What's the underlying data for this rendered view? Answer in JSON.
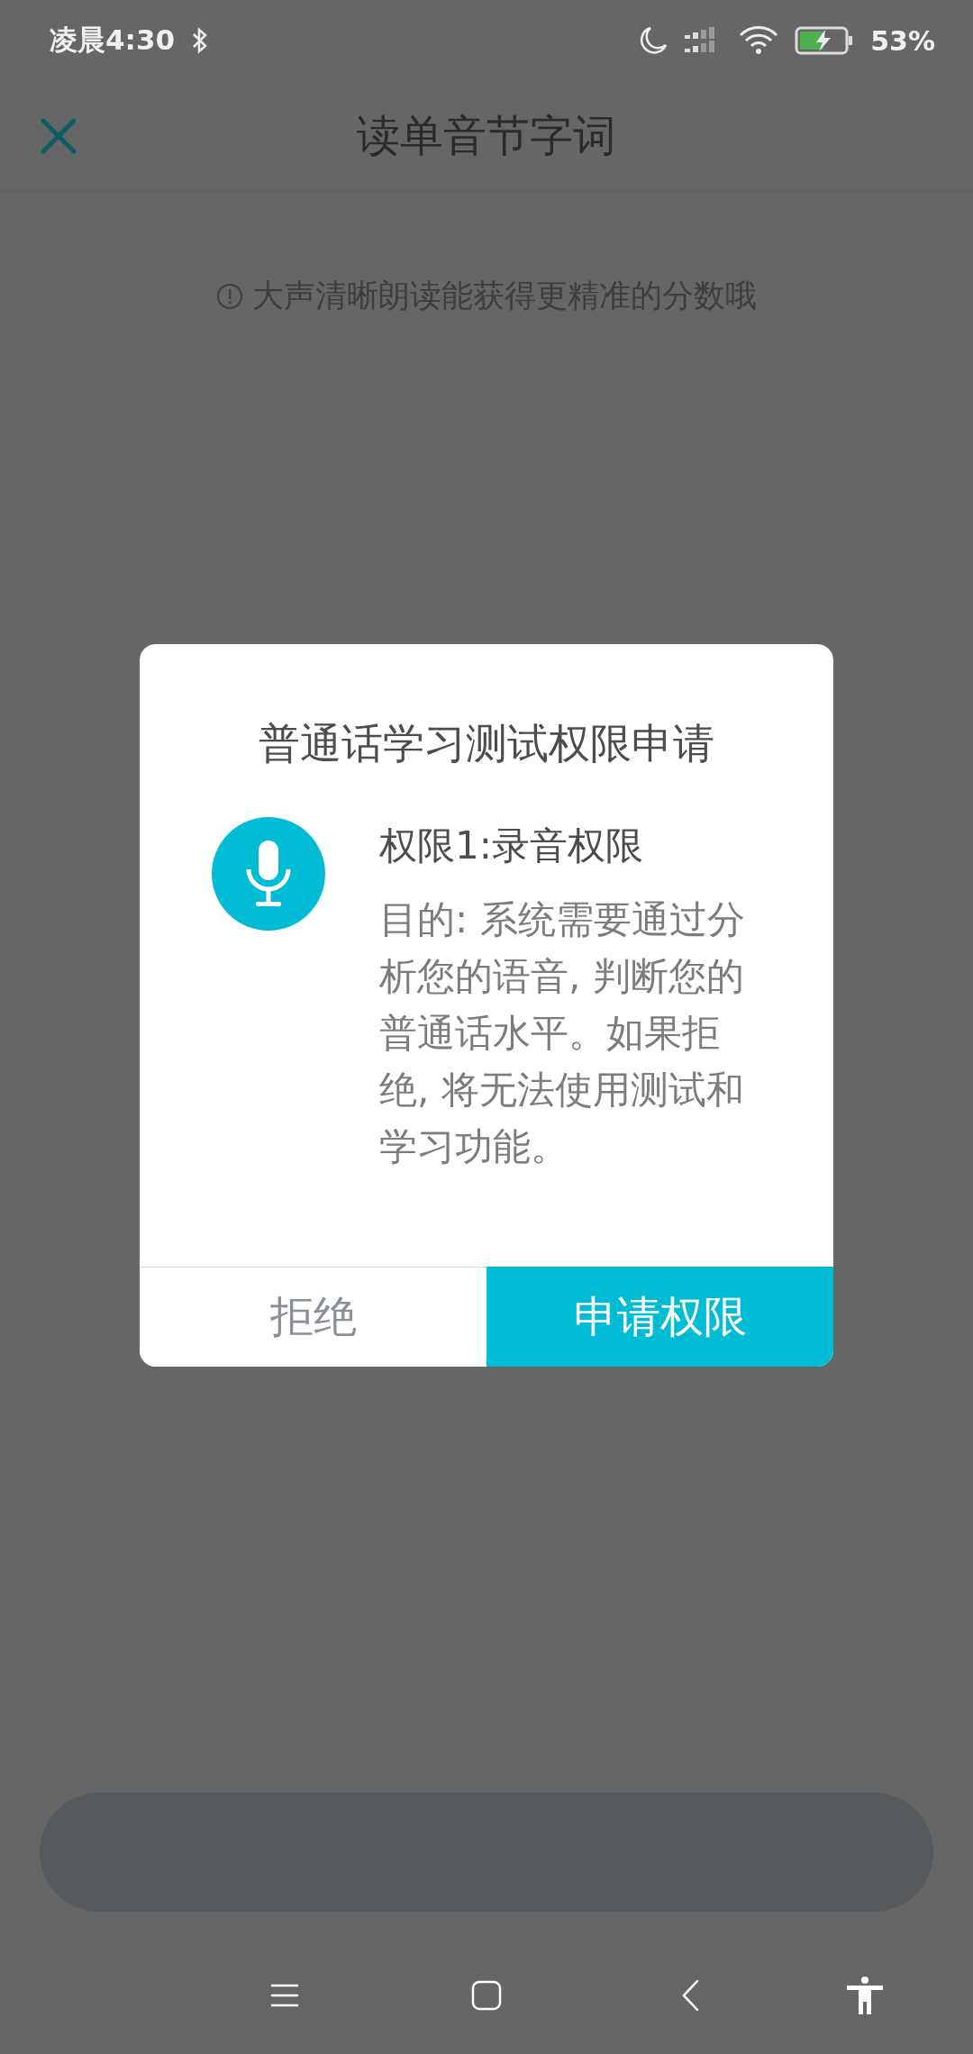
{
  "status_bar": {
    "time": "凌晨4:30",
    "battery": "53%"
  },
  "header": {
    "title": "读单音节字词"
  },
  "hint": "大声清晰朗读能获得更精准的分数哦",
  "dialog": {
    "title": "普通话学习测试权限申请",
    "permissions": [
      {
        "title": "权限1:录音权限",
        "description": "目的: 系统需要通过分析您的语音, 判断您的普通话水平。如果拒绝, 将无法使用测试和学习功能。"
      }
    ],
    "buttons": [
      {
        "label": "拒绝",
        "kind": "secondary"
      },
      {
        "label": "申请权限",
        "kind": "primary"
      }
    ]
  }
}
